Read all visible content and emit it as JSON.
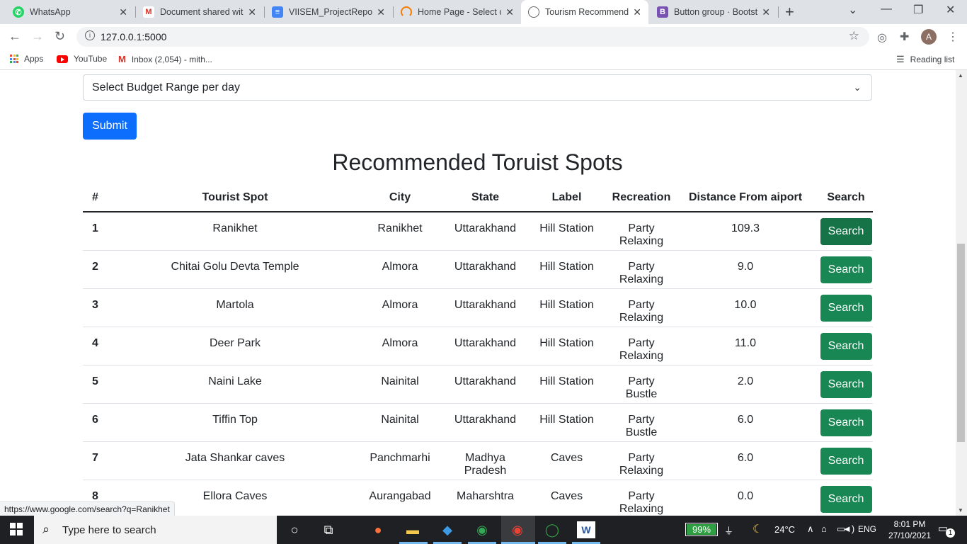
{
  "browser": {
    "tabs": [
      {
        "title": "WhatsApp",
        "icon": "whatsapp-icon",
        "color": "#25d366",
        "active": false
      },
      {
        "title": "Document shared with",
        "icon": "gmail-icon",
        "color": "#d93025",
        "active": false
      },
      {
        "title": "VIISEM_ProjectReport",
        "icon": "docs-icon",
        "color": "#4285f4",
        "active": false
      },
      {
        "title": "Home Page - Select or",
        "icon": "loading-icon",
        "color": "#f57c00",
        "active": false
      },
      {
        "title": "Tourism Recommenda",
        "icon": "globe-icon",
        "color": "#5f6368",
        "active": true
      },
      {
        "title": "Button group · Bootstr",
        "icon": "bootstrap-icon",
        "color": "#7952b3",
        "active": false
      }
    ],
    "address": "127.0.0.1:5000",
    "bookmarks": {
      "apps": "Apps",
      "youtube": "YouTube",
      "inbox": "Inbox (2,054) - mith...",
      "reading_list": "Reading list"
    },
    "avatar_letter": "A",
    "status_url": "https://www.google.com/search?q=Ranikhet"
  },
  "form": {
    "budget_select": "Select Budget Range per day",
    "submit_label": "Submit"
  },
  "results": {
    "heading": "Recommended Toruist Spots",
    "columns": [
      "#",
      "Tourist Spot",
      "City",
      "State",
      "Label",
      "Recreation",
      "Distance From aiport",
      "Search"
    ],
    "search_label": "Search",
    "rows": [
      [
        "1",
        "Ranikhet",
        "Ranikhet",
        "Uttarakhand",
        "Hill Station",
        "Party Relaxing",
        "109.3"
      ],
      [
        "2",
        "Chitai Golu Devta Temple",
        "Almora",
        "Uttarakhand",
        "Hill Station",
        "Party Relaxing",
        "9.0"
      ],
      [
        "3",
        "Martola",
        "Almora",
        "Uttarakhand",
        "Hill Station",
        "Party Relaxing",
        "10.0"
      ],
      [
        "4",
        "Deer Park",
        "Almora",
        "Uttarakhand",
        "Hill Station",
        "Party Relaxing",
        "11.0"
      ],
      [
        "5",
        "Naini Lake",
        "Nainital",
        "Uttarakhand",
        "Hill Station",
        "Party Bustle",
        "2.0"
      ],
      [
        "6",
        "Tiffin Top",
        "Nainital",
        "Uttarakhand",
        "Hill Station",
        "Party Bustle",
        "6.0"
      ],
      [
        "7",
        "Jata Shankar caves",
        "Panchmarhi",
        "Madhya Pradesh",
        "Caves",
        "Party Relaxing",
        "6.0"
      ],
      [
        "8",
        "Ellora Caves",
        "Aurangabad",
        "Maharshtra",
        "Caves",
        "Party Relaxing",
        "0.0"
      ]
    ]
  },
  "taskbar": {
    "search_placeholder": "Type here to search",
    "battery": "99%",
    "battery_level": 0.99,
    "weather": "24°C",
    "language": "ENG",
    "time": "8:01 PM",
    "date": "27/10/2021",
    "notification_count": "1"
  }
}
